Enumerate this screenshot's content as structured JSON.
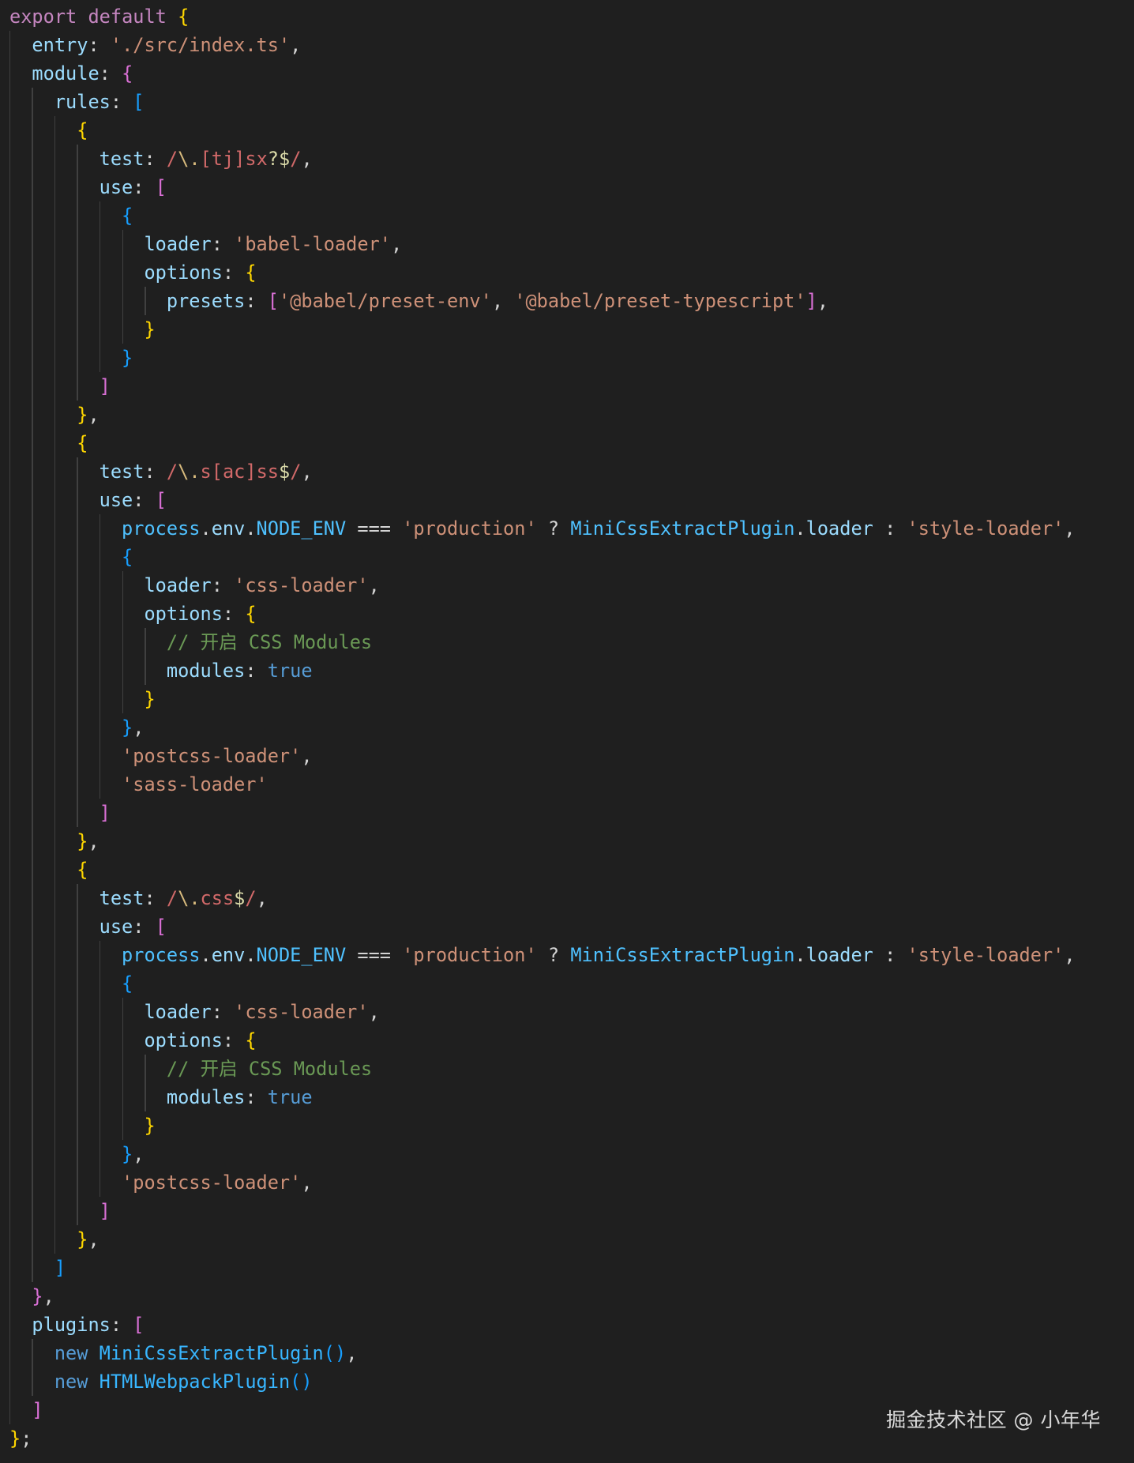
{
  "editor": {
    "language": "javascript",
    "indent_guide_color": "#404040",
    "background": "#1f1f1f",
    "lines": [
      {
        "indent": 0,
        "tokens": [
          [
            "export",
            "key"
          ],
          [
            " ",
            "punc"
          ],
          [
            "default",
            "key"
          ],
          [
            " ",
            "punc"
          ],
          [
            "{",
            "b1"
          ]
        ]
      },
      {
        "indent": 1,
        "tokens": [
          [
            "entry",
            "prop"
          ],
          [
            ": ",
            "punc"
          ],
          [
            "'./src/index.ts'",
            "str"
          ],
          [
            ",",
            "punc"
          ]
        ]
      },
      {
        "indent": 1,
        "tokens": [
          [
            "module",
            "prop"
          ],
          [
            ": ",
            "punc"
          ],
          [
            "{",
            "b2"
          ]
        ]
      },
      {
        "indent": 2,
        "tokens": [
          [
            "rules",
            "prop"
          ],
          [
            ": ",
            "punc"
          ],
          [
            "[",
            "b3"
          ]
        ]
      },
      {
        "indent": 3,
        "tokens": [
          [
            "{",
            "b1"
          ]
        ]
      },
      {
        "indent": 4,
        "tokens": [
          [
            "test",
            "prop"
          ],
          [
            ": ",
            "punc"
          ],
          [
            "/",
            "rx"
          ],
          [
            "\\.",
            "rxmeta"
          ],
          [
            "[tj]",
            "rx"
          ],
          [
            "sx",
            "rx"
          ],
          [
            "?",
            "rxop"
          ],
          [
            "$",
            "rxop"
          ],
          [
            "/",
            "rx"
          ],
          [
            ",",
            "punc"
          ]
        ]
      },
      {
        "indent": 4,
        "tokens": [
          [
            "use",
            "prop"
          ],
          [
            ": ",
            "punc"
          ],
          [
            "[",
            "b2"
          ]
        ]
      },
      {
        "indent": 5,
        "tokens": [
          [
            "{",
            "b3"
          ]
        ]
      },
      {
        "indent": 6,
        "tokens": [
          [
            "loader",
            "prop"
          ],
          [
            ": ",
            "punc"
          ],
          [
            "'babel-loader'",
            "str"
          ],
          [
            ",",
            "punc"
          ]
        ]
      },
      {
        "indent": 6,
        "tokens": [
          [
            "options",
            "prop"
          ],
          [
            ": ",
            "punc"
          ],
          [
            "{",
            "b1"
          ]
        ]
      },
      {
        "indent": 7,
        "tokens": [
          [
            "presets",
            "prop"
          ],
          [
            ": ",
            "punc"
          ],
          [
            "[",
            "b2"
          ],
          [
            "'@babel/preset-env'",
            "str"
          ],
          [
            ", ",
            "punc"
          ],
          [
            "'@babel/preset-typescript'",
            "str"
          ],
          [
            "]",
            "b2"
          ],
          [
            ",",
            "punc"
          ]
        ]
      },
      {
        "indent": 6,
        "tokens": [
          [
            "}",
            "b1"
          ]
        ]
      },
      {
        "indent": 5,
        "tokens": [
          [
            "}",
            "b3"
          ]
        ]
      },
      {
        "indent": 4,
        "tokens": [
          [
            "]",
            "b2"
          ]
        ]
      },
      {
        "indent": 3,
        "tokens": [
          [
            "}",
            "b1"
          ],
          [
            ",",
            "punc"
          ]
        ]
      },
      {
        "indent": 3,
        "tokens": [
          [
            "{",
            "b1"
          ]
        ]
      },
      {
        "indent": 4,
        "tokens": [
          [
            "test",
            "prop"
          ],
          [
            ": ",
            "punc"
          ],
          [
            "/",
            "rx"
          ],
          [
            "\\.",
            "rxmeta"
          ],
          [
            "s",
            "rx"
          ],
          [
            "[ac]",
            "rx"
          ],
          [
            "ss",
            "rx"
          ],
          [
            "$",
            "rxop"
          ],
          [
            "/",
            "rx"
          ],
          [
            ",",
            "punc"
          ]
        ]
      },
      {
        "indent": 4,
        "tokens": [
          [
            "use",
            "prop"
          ],
          [
            ": ",
            "punc"
          ],
          [
            "[",
            "b2"
          ]
        ]
      },
      {
        "indent": 5,
        "tokens": [
          [
            "process",
            "var"
          ],
          [
            ".",
            "punc"
          ],
          [
            "env",
            "prop"
          ],
          [
            ".",
            "punc"
          ],
          [
            "NODE_ENV",
            "var"
          ],
          [
            " === ",
            "punc"
          ],
          [
            "'production'",
            "str"
          ],
          [
            " ? ",
            "punc"
          ],
          [
            "MiniCssExtractPlugin",
            "var"
          ],
          [
            ".",
            "punc"
          ],
          [
            "loader",
            "prop"
          ],
          [
            " : ",
            "punc"
          ],
          [
            "'style-loader'",
            "str"
          ],
          [
            ",",
            "punc"
          ]
        ]
      },
      {
        "indent": 5,
        "tokens": [
          [
            "{",
            "b3"
          ]
        ]
      },
      {
        "indent": 6,
        "tokens": [
          [
            "loader",
            "prop"
          ],
          [
            ": ",
            "punc"
          ],
          [
            "'css-loader'",
            "str"
          ],
          [
            ",",
            "punc"
          ]
        ]
      },
      {
        "indent": 6,
        "tokens": [
          [
            "options",
            "prop"
          ],
          [
            ": ",
            "punc"
          ],
          [
            "{",
            "b1"
          ]
        ]
      },
      {
        "indent": 7,
        "tokens": [
          [
            "// 开启 CSS Modules",
            "cmt"
          ]
        ]
      },
      {
        "indent": 7,
        "tokens": [
          [
            "modules",
            "prop"
          ],
          [
            ": ",
            "punc"
          ],
          [
            "true",
            "bool"
          ]
        ]
      },
      {
        "indent": 6,
        "tokens": [
          [
            "}",
            "b1"
          ]
        ]
      },
      {
        "indent": 5,
        "tokens": [
          [
            "}",
            "b3"
          ],
          [
            ",",
            "punc"
          ]
        ]
      },
      {
        "indent": 5,
        "tokens": [
          [
            "'postcss-loader'",
            "str"
          ],
          [
            ",",
            "punc"
          ]
        ]
      },
      {
        "indent": 5,
        "tokens": [
          [
            "'sass-loader'",
            "str"
          ]
        ]
      },
      {
        "indent": 4,
        "tokens": [
          [
            "]",
            "b2"
          ]
        ]
      },
      {
        "indent": 3,
        "tokens": [
          [
            "}",
            "b1"
          ],
          [
            ",",
            "punc"
          ]
        ]
      },
      {
        "indent": 3,
        "tokens": [
          [
            "{",
            "b1"
          ]
        ]
      },
      {
        "indent": 4,
        "tokens": [
          [
            "test",
            "prop"
          ],
          [
            ": ",
            "punc"
          ],
          [
            "/",
            "rx"
          ],
          [
            "\\.",
            "rxmeta"
          ],
          [
            "css",
            "rx"
          ],
          [
            "$",
            "rxop"
          ],
          [
            "/",
            "rx"
          ],
          [
            ",",
            "punc"
          ]
        ]
      },
      {
        "indent": 4,
        "tokens": [
          [
            "use",
            "prop"
          ],
          [
            ": ",
            "punc"
          ],
          [
            "[",
            "b2"
          ]
        ]
      },
      {
        "indent": 5,
        "tokens": [
          [
            "process",
            "var"
          ],
          [
            ".",
            "punc"
          ],
          [
            "env",
            "prop"
          ],
          [
            ".",
            "punc"
          ],
          [
            "NODE_ENV",
            "var"
          ],
          [
            " === ",
            "punc"
          ],
          [
            "'production'",
            "str"
          ],
          [
            " ? ",
            "punc"
          ],
          [
            "MiniCssExtractPlugin",
            "var"
          ],
          [
            ".",
            "punc"
          ],
          [
            "loader",
            "prop"
          ],
          [
            " : ",
            "punc"
          ],
          [
            "'style-loader'",
            "str"
          ],
          [
            ",",
            "punc"
          ]
        ]
      },
      {
        "indent": 5,
        "tokens": [
          [
            "{",
            "b3"
          ]
        ]
      },
      {
        "indent": 6,
        "tokens": [
          [
            "loader",
            "prop"
          ],
          [
            ": ",
            "punc"
          ],
          [
            "'css-loader'",
            "str"
          ],
          [
            ",",
            "punc"
          ]
        ]
      },
      {
        "indent": 6,
        "tokens": [
          [
            "options",
            "prop"
          ],
          [
            ": ",
            "punc"
          ],
          [
            "{",
            "b1"
          ]
        ]
      },
      {
        "indent": 7,
        "tokens": [
          [
            "// 开启 CSS Modules",
            "cmt"
          ]
        ]
      },
      {
        "indent": 7,
        "tokens": [
          [
            "modules",
            "prop"
          ],
          [
            ": ",
            "punc"
          ],
          [
            "true",
            "bool"
          ]
        ]
      },
      {
        "indent": 6,
        "tokens": [
          [
            "}",
            "b1"
          ]
        ]
      },
      {
        "indent": 5,
        "tokens": [
          [
            "}",
            "b3"
          ],
          [
            ",",
            "punc"
          ]
        ]
      },
      {
        "indent": 5,
        "tokens": [
          [
            "'postcss-loader'",
            "str"
          ],
          [
            ",",
            "punc"
          ]
        ]
      },
      {
        "indent": 4,
        "tokens": [
          [
            "]",
            "b2"
          ]
        ]
      },
      {
        "indent": 3,
        "tokens": [
          [
            "}",
            "b1"
          ],
          [
            ",",
            "punc"
          ]
        ]
      },
      {
        "indent": 2,
        "tokens": [
          [
            "]",
            "b3"
          ]
        ]
      },
      {
        "indent": 1,
        "tokens": [
          [
            "}",
            "b2"
          ],
          [
            ",",
            "punc"
          ]
        ]
      },
      {
        "indent": 1,
        "tokens": [
          [
            "plugins",
            "prop"
          ],
          [
            ": ",
            "punc"
          ],
          [
            "[",
            "b2"
          ]
        ]
      },
      {
        "indent": 2,
        "tokens": [
          [
            "new",
            "kw"
          ],
          [
            " ",
            "punc"
          ],
          [
            "MiniCssExtractPlugin",
            "cls"
          ],
          [
            "()",
            "b3"
          ],
          [
            ",",
            "punc"
          ]
        ]
      },
      {
        "indent": 2,
        "tokens": [
          [
            "new",
            "kw"
          ],
          [
            " ",
            "punc"
          ],
          [
            "HTMLWebpackPlugin",
            "cls"
          ],
          [
            "()",
            "b3"
          ]
        ]
      },
      {
        "indent": 1,
        "tokens": [
          [
            "]",
            "b2"
          ]
        ]
      },
      {
        "indent": 0,
        "tokens": [
          [
            "}",
            "b1"
          ],
          [
            ";",
            "punc"
          ]
        ]
      }
    ]
  },
  "watermark": {
    "text": "掘金技术社区 @ 小年华"
  }
}
